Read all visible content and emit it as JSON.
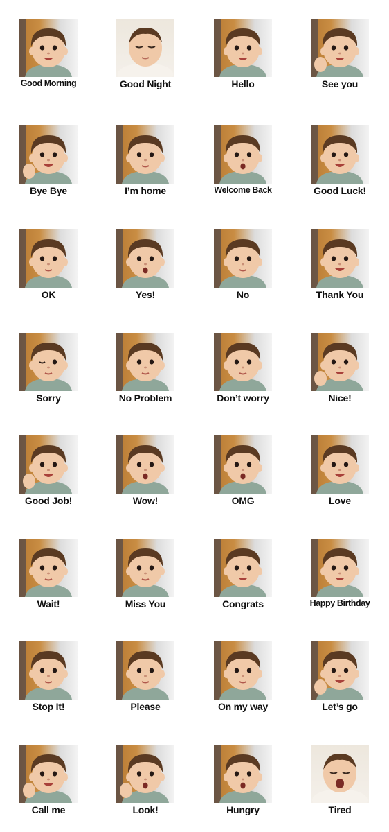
{
  "stickers": [
    {
      "label": "Good Morning",
      "face": "smile",
      "hand": false
    },
    {
      "label": "Good Night",
      "face": "sleep",
      "hand": false
    },
    {
      "label": "Hello",
      "face": "smile",
      "hand": false
    },
    {
      "label": "See you",
      "face": "smile",
      "hand": true
    },
    {
      "label": "Bye Bye",
      "face": "smile",
      "hand": true
    },
    {
      "label": "I’m home",
      "face": "neutral",
      "hand": false
    },
    {
      "label": "Welcome Back",
      "face": "o",
      "hand": false
    },
    {
      "label": "Good Luck!",
      "face": "smile",
      "hand": false
    },
    {
      "label": "OK",
      "face": "neutral",
      "hand": false
    },
    {
      "label": "Yes!",
      "face": "o",
      "hand": false
    },
    {
      "label": "No",
      "face": "neutral",
      "hand": false
    },
    {
      "label": "Thank You",
      "face": "smile",
      "hand": false
    },
    {
      "label": "Sorry",
      "face": "wink",
      "hand": false
    },
    {
      "label": "No Problem",
      "face": "neutral",
      "hand": false
    },
    {
      "label": "Don’t worry",
      "face": "neutral",
      "hand": false
    },
    {
      "label": "Nice!",
      "face": "smile",
      "hand": true
    },
    {
      "label": "Good Job!",
      "face": "smile",
      "hand": true
    },
    {
      "label": "Wow!",
      "face": "o",
      "hand": false
    },
    {
      "label": "OMG",
      "face": "o",
      "hand": false
    },
    {
      "label": "Love",
      "face": "smile",
      "hand": false
    },
    {
      "label": "Wait!",
      "face": "neutral",
      "hand": false
    },
    {
      "label": "Miss You",
      "face": "neutral",
      "hand": false
    },
    {
      "label": "Congrats",
      "face": "smile",
      "hand": false
    },
    {
      "label": "Happy Birthday",
      "face": "smile",
      "hand": false
    },
    {
      "label": "Stop It!",
      "face": "neutral",
      "hand": false
    },
    {
      "label": "Please",
      "face": "neutral",
      "hand": false
    },
    {
      "label": "On my way",
      "face": "neutral",
      "hand": false
    },
    {
      "label": "Let’s go",
      "face": "smile",
      "hand": true
    },
    {
      "label": "Call me",
      "face": "smile",
      "hand": true
    },
    {
      "label": "Look!",
      "face": "o",
      "hand": true
    },
    {
      "label": "Hungry",
      "face": "o",
      "hand": false
    },
    {
      "label": "Tired",
      "face": "yawn",
      "hand": false
    }
  ],
  "colors": {
    "background": "#ffffff",
    "label_text": "#111111",
    "skin": "#f0c9a8",
    "hair": "#5a3a22",
    "shirt": "#8fa79a",
    "wall_wood": "#c98d43"
  }
}
